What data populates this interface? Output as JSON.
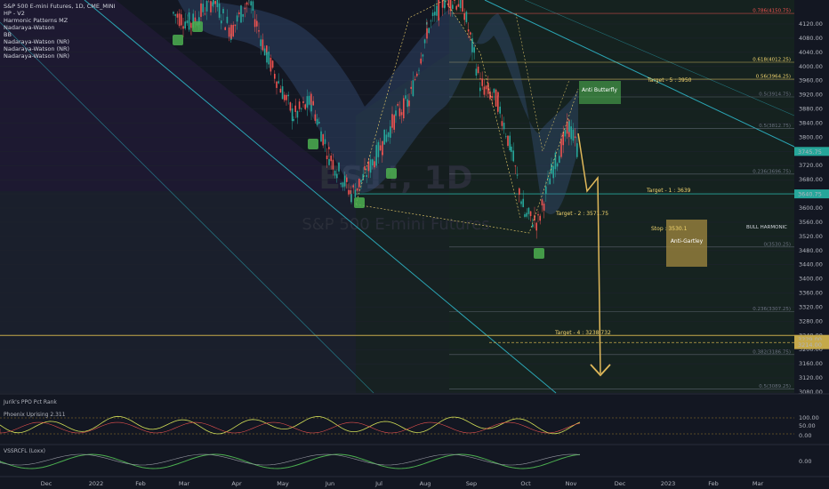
{
  "header": {
    "symbol_line": "S&P 500 E-mini Futures, 1D, CME_MINI",
    "indicators": [
      "HP - V2",
      "Harmonic Patterns MZ",
      "Nadaraya-Watson",
      "BB",
      "Nadaraya-Watson (NR)",
      "Nadaraya-Watson (NR)",
      "Nadaraya-Watson (NR)"
    ]
  },
  "watermark": {
    "ticker": "ES1!, 1D",
    "name": "S&P 500 E-mini Futures"
  },
  "panes": {
    "osc1": "Jurik's PPO Pct Rank",
    "osc2": "Phoenix Uprising 2.311",
    "osc3": "VSSRCFL (Loxx)"
  },
  "chart_data": {
    "type": "candlestick",
    "title": "S&P 500 E-mini Futures, 1D, CME_MINI",
    "y_range": [
      3040,
      4190
    ],
    "y_ticks": [
      4120,
      4080,
      4040,
      4000,
      3960,
      3920,
      3880,
      3840,
      3800,
      3760,
      3720,
      3680,
      3640,
      3600,
      3560,
      3520,
      3480,
      3440,
      3400,
      3360,
      3320,
      3280,
      3240,
      3200,
      3160,
      3120,
      3080
    ],
    "x_ticks": [
      "Dec",
      "2022",
      "Feb",
      "Mar",
      "Apr",
      "May",
      "Jun",
      "Jul",
      "Aug",
      "Sep",
      "Oct",
      "Nov",
      "Dec",
      "2023",
      "Feb",
      "Mar"
    ],
    "price_labels": [
      {
        "text": "3745.75",
        "value": 3760,
        "color": "#26a69a"
      },
      {
        "text": "3229.00",
        "value": 3229,
        "color": "#c5a94a"
      },
      {
        "text": "3214.00",
        "value": 3214,
        "color": "#c5a94a"
      },
      {
        "text": "3640.75",
        "value": 3640,
        "color": "#26a69a"
      }
    ],
    "fib_levels": [
      {
        "text": "0.786(4150.75)",
        "value": 4150,
        "color": "#ef5350"
      },
      {
        "text": "0.618(4012.25)",
        "value": 4012,
        "color": "#f5d76e"
      },
      {
        "text": "0.56(3964.25)",
        "value": 3964,
        "color": "#f5d76e"
      },
      {
        "text": "0.5(3914.75)",
        "value": 3914,
        "color": "#6b7280"
      },
      {
        "text": "0.5(3812.75)",
        "value": 3825,
        "color": "#6b7280"
      },
      {
        "text": "0.236(3696.75)",
        "value": 3696,
        "color": "#6b7280"
      },
      {
        "text": "0(3530.25)",
        "value": 3490,
        "color": "#6b7280"
      },
      {
        "text": "0.236(3307.25)",
        "value": 3307,
        "color": "#6b7280"
      },
      {
        "text": "0.382(3186.75)",
        "value": 3186,
        "color": "#6b7280"
      },
      {
        "text": "0.5(3089.25)",
        "value": 3089,
        "color": "#6b7280"
      }
    ],
    "targets": [
      {
        "text": "Target - 5 : 3950",
        "value": 3950
      },
      {
        "text": "Target - 1 : 3639",
        "value": 3639
      },
      {
        "text": "Target - 2 : 3571.75",
        "value": 3571
      },
      {
        "text": "Stop : 3530.1",
        "value": 3530
      },
      {
        "text": "Target - 4 : 3238.732",
        "value": 3238
      }
    ],
    "pattern_labels": [
      {
        "text": "Anti Butterfly",
        "color": "#4caf50"
      },
      {
        "text": "Anti-Gartley",
        "color": "#c5a94a"
      },
      {
        "text": "BULL HARMONIC",
        "color": "#d1d4dc"
      }
    ],
    "price_axis_ticks_visible": true
  }
}
